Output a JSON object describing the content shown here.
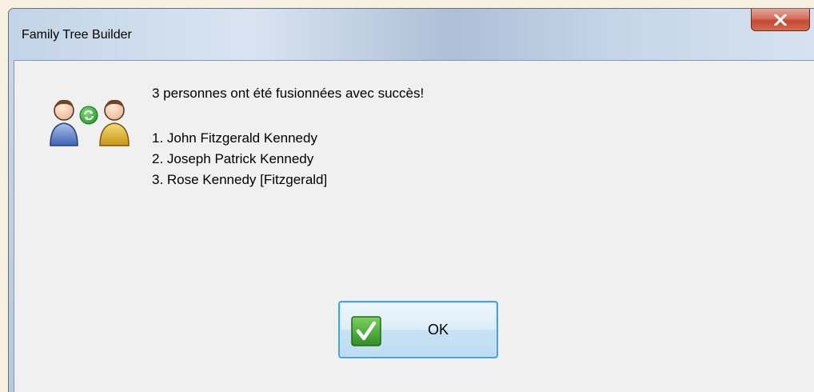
{
  "window": {
    "title": "Family Tree Builder",
    "close_symbol": "x"
  },
  "dialog": {
    "icon": "merge-persons-icon",
    "message": "3 personnes ont été fusionnées avec succès!",
    "merged_persons": [
      "1. John Fitzgerald Kennedy",
      "2. Joseph Patrick Kennedy",
      "3. Rose Kennedy [Fitzgerald]"
    ],
    "ok_button": {
      "label": "OK",
      "icon": "checkmark-icon"
    }
  },
  "colors": {
    "accent_border": "#4aa3d9",
    "check_green": "#3a9a2a",
    "close_red": "#c14a32"
  }
}
